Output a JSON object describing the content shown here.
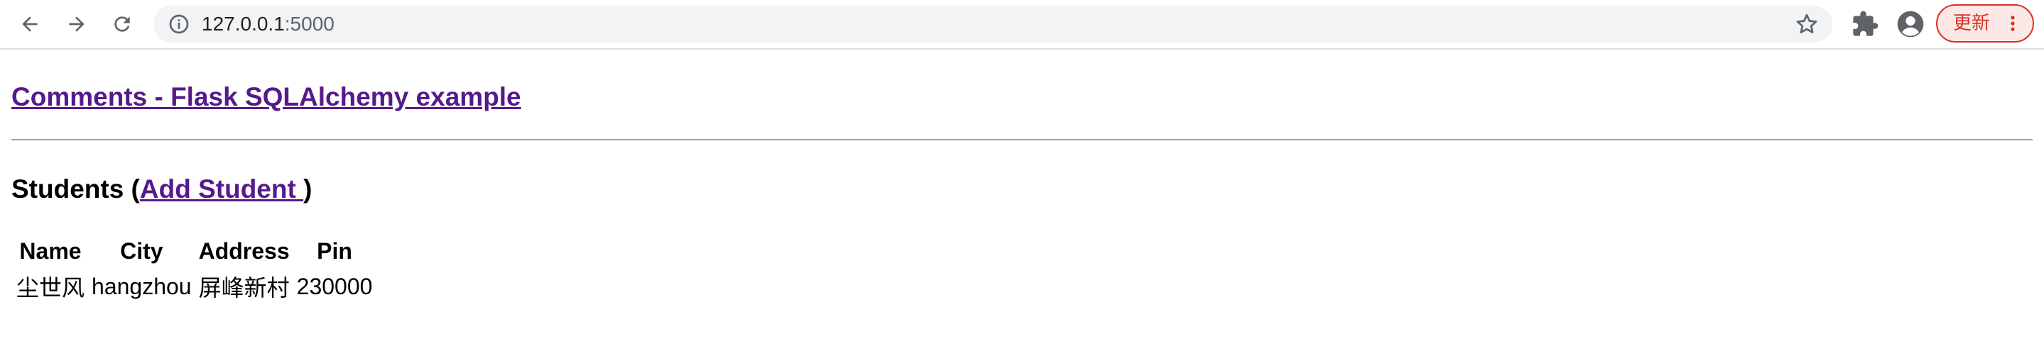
{
  "browser": {
    "url_host": "127.0.0.1",
    "url_port": ":5000",
    "update_label": "更新"
  },
  "icons": {
    "back": "arrow-left-icon",
    "forward": "arrow-right-icon",
    "reload": "reload-icon",
    "site_info": "info-icon",
    "bookmark": "star-icon",
    "extensions": "puzzle-icon",
    "profile": "account-icon",
    "menu": "kebab-menu-icon"
  },
  "colors": {
    "link_visited": "#551a8b",
    "update_red": "#d93025"
  },
  "page": {
    "title_link": "Comments - Flask SQLAlchemy example",
    "section_prefix": "Students (",
    "add_student_link": "Add Student ",
    "section_suffix": ")",
    "table": {
      "headers": [
        "Name",
        "City",
        "Address",
        "Pin"
      ],
      "rows": [
        [
          "尘世风",
          "hangzhou",
          "屏峰新村",
          "230000"
        ]
      ]
    }
  }
}
